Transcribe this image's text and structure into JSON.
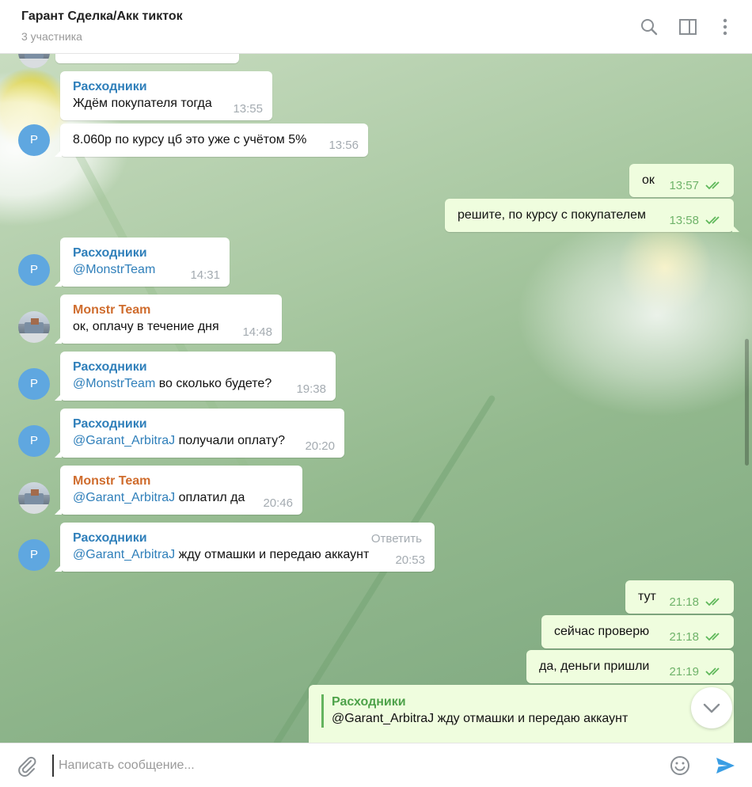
{
  "header": {
    "title": "Гарант Сделка/Акк тикток",
    "subtitle": "3 участника"
  },
  "messages": [
    {
      "sender": "Расходники",
      "text": "Ждём покупателя тогда",
      "time": "13:55"
    },
    {
      "text": "8.060р по курсу цб это уже с учётом 5%",
      "time": "13:56",
      "avatar": "Р"
    },
    {
      "text": "ок",
      "time": "13:57",
      "outgoing": true
    },
    {
      "text": "решите, по курсу с покупателем",
      "time": "13:58",
      "outgoing": true
    },
    {
      "sender": "Расходники",
      "mention": "@MonstrTeam",
      "text": "",
      "time": "14:31",
      "avatar": "Р"
    },
    {
      "sender": "Monstr Team",
      "text": "ок, оплачу в течение дня",
      "time": "14:48"
    },
    {
      "sender": "Расходники",
      "mention": "@MonstrTeam",
      "text": " во сколько будете?",
      "time": "19:38",
      "avatar": "Р"
    },
    {
      "sender": "Расходники",
      "mention": "@Garant_ArbitraJ",
      "text": " получали оплату?",
      "time": "20:20",
      "avatar": "Р"
    },
    {
      "sender": "Monstr Team",
      "mention": "@Garant_ArbitraJ",
      "text": " оплатил да",
      "time": "20:46"
    },
    {
      "sender": "Расходники",
      "mention": "@Garant_ArbitraJ",
      "text": " жду отмашки и передаю аккаунт",
      "time": "20:53",
      "avatar": "Р",
      "reply_label": "Ответить"
    },
    {
      "text": "тут",
      "time": "21:18",
      "outgoing": true
    },
    {
      "text": "сейчас проверю",
      "time": "21:18",
      "outgoing": true
    },
    {
      "text": "да, деньги пришли",
      "time": "21:19",
      "outgoing": true
    },
    {
      "quote_sender": "Расходники",
      "quote_text": "@Garant_ArbitraJ жду отмашки и передаю аккаунт",
      "outgoing": true
    }
  ],
  "composer": {
    "placeholder": "Написать сообщение..."
  },
  "colors": {
    "link": "#2f7fba",
    "outgoing_bubble": "#effdde",
    "send_icon": "#3a9ee4",
    "read_check": "#5fb85a"
  }
}
